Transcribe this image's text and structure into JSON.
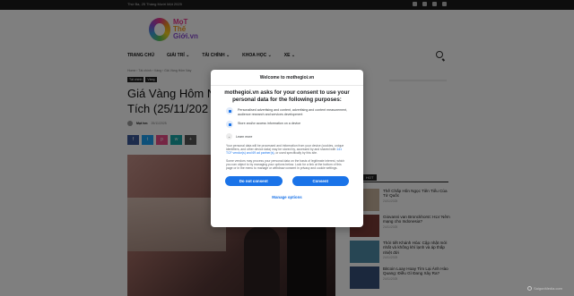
{
  "topbar": {
    "date": "Thứ Ba, 25 Tháng Mười Một 2025"
  },
  "logo": {
    "line1": "MọT",
    "line2": "Thế",
    "line3": "Giới.vn"
  },
  "nav": {
    "items": [
      "TRANG CHỦ",
      "GIẢI TRÍ ⌄",
      "TÀI CHÍNH ⌄",
      "KHOA HỌC ⌄",
      "XE ⌄"
    ]
  },
  "article": {
    "breadcrumb": "Home › Tài chính › Vàng › Giá Vàng Hôm Nay",
    "tags": [
      "Tài chính",
      "Vàng"
    ],
    "headline_line1": "Giá Vàng Hôm N",
    "headline_line2": "Tích (25/11/202",
    "author": "Mọt hm",
    "date": "25/11/2025",
    "share_colors": [
      "#3b5998",
      "#1da1f2",
      "#ea4c89",
      "#16a6a7",
      "#555555"
    ]
  },
  "sidebar": {
    "hot_label": "HOT",
    "items": [
      {
        "title": "Thế Chấp Hôn Ngọc Tiên Tiểu Của Tử Quốc",
        "date": "24/11/2025",
        "color": "#c7b29c"
      },
      {
        "title": "Giovanni van Bronckhorst: HLV Nêm mạng cho Indonesia?",
        "date": "24/11/2025",
        "color": "#7a3a34"
      },
      {
        "title": "Thời tiết Khánh Hòa: Cập nhật mới nhất và khống khí lạnh và áp thấp nhiệt đới",
        "date": "24/11/2025",
        "color": "#4f8da8"
      },
      {
        "title": "Bitcoin Loay Hoay Tìm Lại Ánh Hào Quang: Điều Gì Đang Xảy Ra?",
        "date": "24/11/2025",
        "color": "#36507a"
      }
    ]
  },
  "modal": {
    "header": "Welcome to mothegioi.vn",
    "title": "mothegioi.vn asks for your consent to use your personal data for the following purposes:",
    "purposes": [
      "Personalised advertising and content, advertising and content measurement, audience research and services development",
      "Store and/or access information on a device"
    ],
    "learn_more": "Learn more",
    "body1_a": "Your personal data will be processed and information from your device (cookies, unique identifiers, and other device data) may be stored by, accessed by and shared with ",
    "body1_link": "141 TCF vendor(s) and 69 ad partner(s)",
    "body1_b": ", or used specifically by this site.",
    "body2": "Some vendors may process your personal data on the basis of legitimate interest, which you can object to by managing your options below. Look for a link at the bottom of this page or in the menu to manage or withdraw consent in privacy and cookie settings.",
    "do_not_consent": "Do not consent",
    "consent": "Consent",
    "manage_options": "Manage options"
  },
  "watermark": "SaigonMedia.com"
}
